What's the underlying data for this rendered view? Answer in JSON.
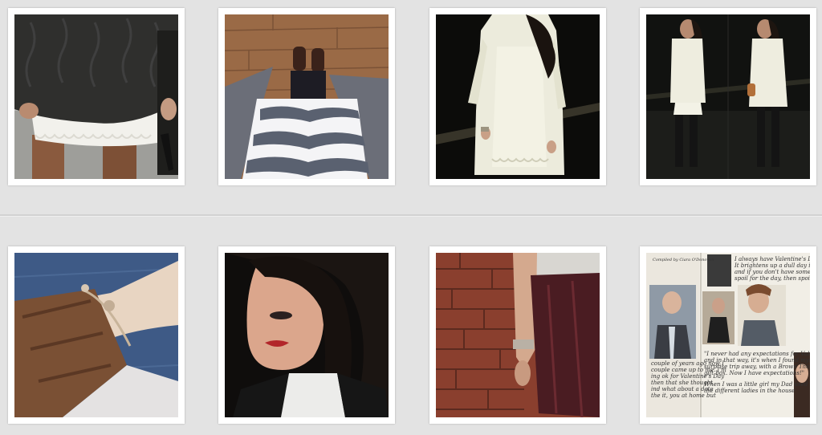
{
  "gallery": {
    "photos": [
      {
        "id": "photo-1",
        "subject": "knit-sweater-lace-skirt"
      },
      {
        "id": "photo-2",
        "subject": "striped-skirt-boots-floor"
      },
      {
        "id": "photo-3",
        "subject": "cream-coat-lace-dress-night"
      },
      {
        "id": "photo-4",
        "subject": "cream-coat-outfit-two-poses"
      },
      {
        "id": "photo-5",
        "subject": "bangle-leather-jacket"
      },
      {
        "id": "photo-6",
        "subject": "portrait-red-lips"
      },
      {
        "id": "photo-7",
        "subject": "burgundy-leather-skirt-brick-wall"
      },
      {
        "id": "photo-8",
        "subject": "magazine-page"
      }
    ]
  },
  "magazine": {
    "quote_top": "I always have Valentine's Day. It brightens up a dull day in February and if you don't have someone to spoil for the day, then spoil yourself",
    "quote_mid": "\"I never had any expectations for Valentine's Day, and in that way, it's when I found myself in a surprise trip away, with a Brown Thomas gift box. Now I have expectations!\"",
    "quote_low": "When I was a little girl my Dad used to give cards to the different ladies in the house",
    "byline": "Compiled by Ciara O'Donovan"
  },
  "colors": {
    "background": "#e3e3e3",
    "frame": "#ffffff"
  }
}
